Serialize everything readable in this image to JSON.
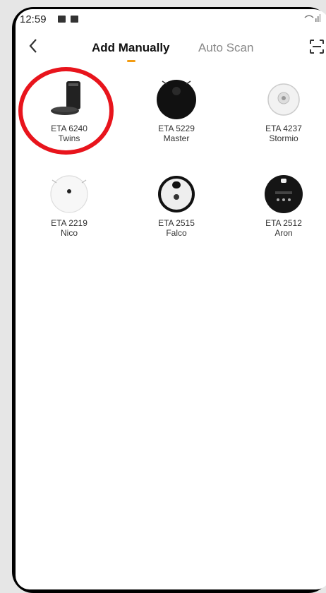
{
  "status_bar": {
    "time": "12:59"
  },
  "nav": {
    "back_icon": "chevron-left-icon",
    "tab_active": "Add Manually",
    "tab_inactive": "Auto Scan",
    "accent": "#f39c12"
  },
  "devices": [
    {
      "model": "ETA 6240",
      "name": "Twins"
    },
    {
      "model": "ETA 5229",
      "name": "Master"
    },
    {
      "model": "ETA 4237",
      "name": "Stormio"
    },
    {
      "model": "ETA 2219",
      "name": "Nico"
    },
    {
      "model": "ETA 2515",
      "name": "Falco"
    },
    {
      "model": "ETA 2512",
      "name": "Aron"
    }
  ],
  "annotation": {
    "color": "#e8141c"
  }
}
